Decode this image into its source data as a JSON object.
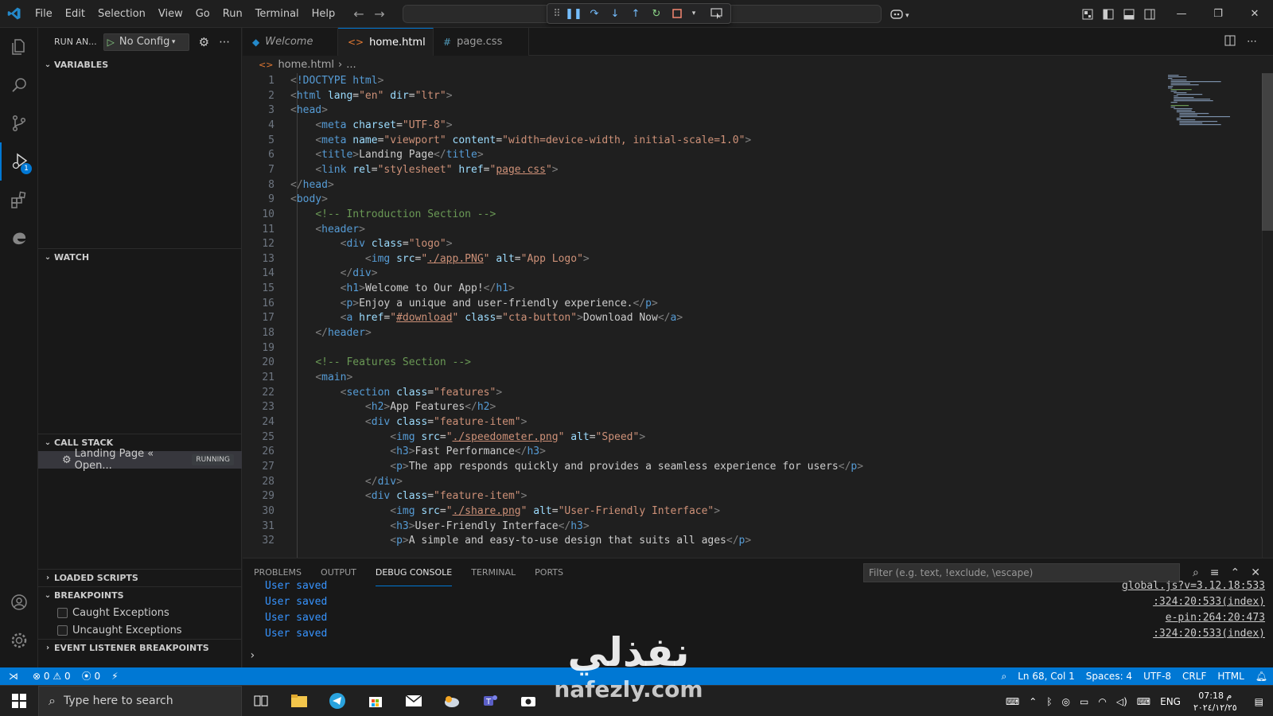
{
  "menu": [
    "File",
    "Edit",
    "Selection",
    "View",
    "Go",
    "Run",
    "Terminal",
    "Help"
  ],
  "sidebar": {
    "title": "RUN AN...",
    "config": "No Configu",
    "sections": {
      "variables": "VARIABLES",
      "watch": "WATCH",
      "call_stack": "CALL STACK",
      "loaded_scripts": "LOADED SCRIPTS",
      "breakpoints": "BREAKPOINTS",
      "event_listener_breakpoints": "EVENT LISTENER BREAKPOINTS"
    },
    "call_stack_item": "Landing Page « Open...",
    "call_stack_status": "RUNNING",
    "breakpoint_items": [
      "Caught Exceptions",
      "Uncaught Exceptions"
    ],
    "debug_badge": "1"
  },
  "tabs": [
    {
      "label": "Welcome",
      "icon": "vscode-icon"
    },
    {
      "label": "home.html",
      "icon": "html-icon"
    },
    {
      "label": "page.css",
      "icon": "css-icon"
    }
  ],
  "breadcrumb": {
    "file": "home.html",
    "rest": "..."
  },
  "code_lines": [
    "<!DOCTYPE html>",
    "<html lang=\"en\" dir=\"ltr\">",
    "<head>",
    "    <meta charset=\"UTF-8\">",
    "    <meta name=\"viewport\" content=\"width=device-width, initial-scale=1.0\">",
    "    <title>Landing Page</title>",
    "    <link rel=\"stylesheet\" href=\"page.css\">",
    "</head>",
    "<body>",
    "    <!-- Introduction Section -->",
    "    <header>",
    "        <div class=\"logo\">",
    "            <img src=\"./app.PNG\" alt=\"App Logo\">",
    "        </div>",
    "        <h1>Welcome to Our App!</h1>",
    "        <p>Enjoy a unique and user-friendly experience.</p>",
    "        <a href=\"#download\" class=\"cta-button\">Download Now</a>",
    "    </header>",
    "",
    "    <!-- Features Section -->",
    "    <main>",
    "        <section class=\"features\">",
    "            <h2>App Features</h2>",
    "            <div class=\"feature-item\">",
    "                <img src=\"./speedometer.png\" alt=\"Speed\">",
    "                <h3>Fast Performance</h3>",
    "                <p>The app responds quickly and provides a seamless experience for users</p>",
    "            </div>",
    "            <div class=\"feature-item\">",
    "                <img src=\"./share.png\" alt=\"User-Friendly Interface\">",
    "                <h3>User-Friendly Interface</h3>",
    "                <p>A simple and easy-to-use design that suits all ages</p>"
  ],
  "panel": {
    "tabs": [
      "PROBLEMS",
      "OUTPUT",
      "DEBUG CONSOLE",
      "TERMINAL",
      "PORTS"
    ],
    "active_tab": "DEBUG CONSOLE",
    "filter_placeholder": "Filter (e.g. text, !exclude, \\escape)",
    "console_lines": [
      {
        "msg": "User saved",
        "src": "global.js?v=3.12.18:533"
      },
      {
        "msg": "User saved",
        "src": ":324:20:533(index)"
      },
      {
        "msg": "User saved",
        "src": "e-pin:264:20:473"
      },
      {
        "msg": "User saved",
        "src": ":324:20:533(index)"
      }
    ]
  },
  "statusbar": {
    "errors": "0",
    "warnings": "0",
    "ports": "0",
    "position": "Ln 68, Col 1",
    "spaces": "Spaces: 4",
    "encoding": "UTF-8",
    "eol": "CRLF",
    "language": "HTML"
  },
  "taskbar": {
    "search_placeholder": "Type here to search",
    "lang": "ENG",
    "time": "07:18 م",
    "date": "٢٠٢٤/١٢/٢٥"
  },
  "watermark": {
    "arabic": "نفذلي",
    "url": "nafezly.com"
  },
  "colors": {
    "accent": "#0078d4",
    "editor_bg": "#1f1f1f",
    "sidebar_bg": "#181818",
    "tag": "#569cd6",
    "attr": "#9cdcfe",
    "string": "#ce9178",
    "comment": "#6a9955",
    "console_msg": "#3794ff"
  }
}
